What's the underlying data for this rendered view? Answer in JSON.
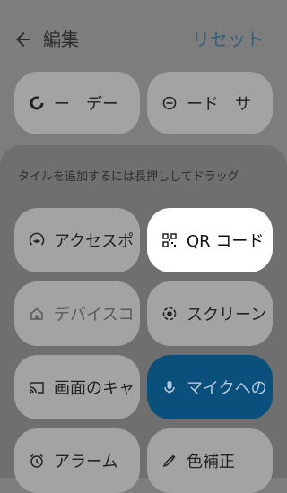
{
  "header": {
    "title": "編集",
    "reset_label": "リセット"
  },
  "active_tiles": [
    {
      "label": "ー　デー",
      "icon": "data-saver-icon"
    },
    {
      "label": "ード　サ",
      "icon": "minus-circle-icon"
    }
  ],
  "hint": "タイルを追加するには長押ししてドラッグ",
  "available_tiles": [
    {
      "label": "アクセスポ",
      "icon": "hotspot-icon"
    },
    {
      "label": "QR コード",
      "icon": "qr-code-icon"
    },
    {
      "label": "デバイスコ",
      "icon": "home-icon"
    },
    {
      "label": "スクリーン",
      "icon": "screen-record-icon"
    },
    {
      "label": "画面のキャ",
      "icon": "cast-icon"
    },
    {
      "label": "マイクへの",
      "icon": "mic-icon"
    },
    {
      "label": "アラーム",
      "icon": "alarm-icon"
    },
    {
      "label": "色補正",
      "icon": "eyedropper-icon"
    }
  ]
}
